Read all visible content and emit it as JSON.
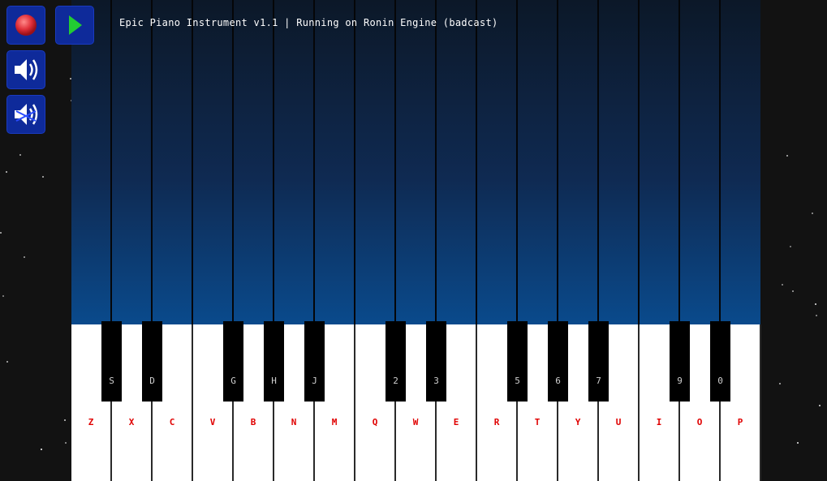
{
  "title": "Epic Piano Instrument v1.1 | Running on Ronin Engine (badcast)",
  "controls": [
    {
      "name": "record-button",
      "icon": "record-icon"
    },
    {
      "name": "play-button",
      "icon": "play-icon"
    },
    {
      "name": "volume-button",
      "icon": "speaker-icon"
    },
    {
      "name": "mute-button",
      "icon": "speaker-muted-icon"
    }
  ],
  "colors": {
    "control_bg": "#0e2a9a",
    "record": "#e0303a",
    "play": "#22cc33",
    "white_label": "#e00000",
    "black_label": "#cfcfcf"
  },
  "white_keys": [
    "Z",
    "X",
    "C",
    "V",
    "B",
    "N",
    "M",
    "Q",
    "W",
    "E",
    "R",
    "T",
    "Y",
    "U",
    "I",
    "O",
    "P"
  ],
  "black_keys": [
    "S",
    "D",
    "",
    "G",
    "H",
    "J",
    "",
    "2",
    "3",
    "",
    "5",
    "6",
    "7",
    "",
    "9",
    "0"
  ]
}
